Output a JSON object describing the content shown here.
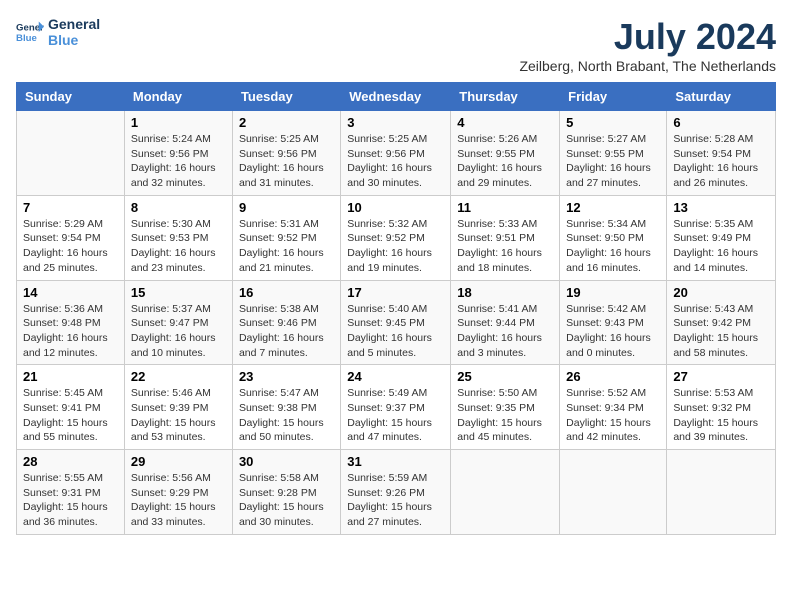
{
  "logo": {
    "line1": "General",
    "line2": "Blue"
  },
  "title": "July 2024",
  "location": "Zeilberg, North Brabant, The Netherlands",
  "headers": [
    "Sunday",
    "Monday",
    "Tuesday",
    "Wednesday",
    "Thursday",
    "Friday",
    "Saturday"
  ],
  "weeks": [
    [
      {
        "day": "",
        "info": ""
      },
      {
        "day": "1",
        "info": "Sunrise: 5:24 AM\nSunset: 9:56 PM\nDaylight: 16 hours\nand 32 minutes."
      },
      {
        "day": "2",
        "info": "Sunrise: 5:25 AM\nSunset: 9:56 PM\nDaylight: 16 hours\nand 31 minutes."
      },
      {
        "day": "3",
        "info": "Sunrise: 5:25 AM\nSunset: 9:56 PM\nDaylight: 16 hours\nand 30 minutes."
      },
      {
        "day": "4",
        "info": "Sunrise: 5:26 AM\nSunset: 9:55 PM\nDaylight: 16 hours\nand 29 minutes."
      },
      {
        "day": "5",
        "info": "Sunrise: 5:27 AM\nSunset: 9:55 PM\nDaylight: 16 hours\nand 27 minutes."
      },
      {
        "day": "6",
        "info": "Sunrise: 5:28 AM\nSunset: 9:54 PM\nDaylight: 16 hours\nand 26 minutes."
      }
    ],
    [
      {
        "day": "7",
        "info": "Sunrise: 5:29 AM\nSunset: 9:54 PM\nDaylight: 16 hours\nand 25 minutes."
      },
      {
        "day": "8",
        "info": "Sunrise: 5:30 AM\nSunset: 9:53 PM\nDaylight: 16 hours\nand 23 minutes."
      },
      {
        "day": "9",
        "info": "Sunrise: 5:31 AM\nSunset: 9:52 PM\nDaylight: 16 hours\nand 21 minutes."
      },
      {
        "day": "10",
        "info": "Sunrise: 5:32 AM\nSunset: 9:52 PM\nDaylight: 16 hours\nand 19 minutes."
      },
      {
        "day": "11",
        "info": "Sunrise: 5:33 AM\nSunset: 9:51 PM\nDaylight: 16 hours\nand 18 minutes."
      },
      {
        "day": "12",
        "info": "Sunrise: 5:34 AM\nSunset: 9:50 PM\nDaylight: 16 hours\nand 16 minutes."
      },
      {
        "day": "13",
        "info": "Sunrise: 5:35 AM\nSunset: 9:49 PM\nDaylight: 16 hours\nand 14 minutes."
      }
    ],
    [
      {
        "day": "14",
        "info": "Sunrise: 5:36 AM\nSunset: 9:48 PM\nDaylight: 16 hours\nand 12 minutes."
      },
      {
        "day": "15",
        "info": "Sunrise: 5:37 AM\nSunset: 9:47 PM\nDaylight: 16 hours\nand 10 minutes."
      },
      {
        "day": "16",
        "info": "Sunrise: 5:38 AM\nSunset: 9:46 PM\nDaylight: 16 hours\nand 7 minutes."
      },
      {
        "day": "17",
        "info": "Sunrise: 5:40 AM\nSunset: 9:45 PM\nDaylight: 16 hours\nand 5 minutes."
      },
      {
        "day": "18",
        "info": "Sunrise: 5:41 AM\nSunset: 9:44 PM\nDaylight: 16 hours\nand 3 minutes."
      },
      {
        "day": "19",
        "info": "Sunrise: 5:42 AM\nSunset: 9:43 PM\nDaylight: 16 hours\nand 0 minutes."
      },
      {
        "day": "20",
        "info": "Sunrise: 5:43 AM\nSunset: 9:42 PM\nDaylight: 15 hours\nand 58 minutes."
      }
    ],
    [
      {
        "day": "21",
        "info": "Sunrise: 5:45 AM\nSunset: 9:41 PM\nDaylight: 15 hours\nand 55 minutes."
      },
      {
        "day": "22",
        "info": "Sunrise: 5:46 AM\nSunset: 9:39 PM\nDaylight: 15 hours\nand 53 minutes."
      },
      {
        "day": "23",
        "info": "Sunrise: 5:47 AM\nSunset: 9:38 PM\nDaylight: 15 hours\nand 50 minutes."
      },
      {
        "day": "24",
        "info": "Sunrise: 5:49 AM\nSunset: 9:37 PM\nDaylight: 15 hours\nand 47 minutes."
      },
      {
        "day": "25",
        "info": "Sunrise: 5:50 AM\nSunset: 9:35 PM\nDaylight: 15 hours\nand 45 minutes."
      },
      {
        "day": "26",
        "info": "Sunrise: 5:52 AM\nSunset: 9:34 PM\nDaylight: 15 hours\nand 42 minutes."
      },
      {
        "day": "27",
        "info": "Sunrise: 5:53 AM\nSunset: 9:32 PM\nDaylight: 15 hours\nand 39 minutes."
      }
    ],
    [
      {
        "day": "28",
        "info": "Sunrise: 5:55 AM\nSunset: 9:31 PM\nDaylight: 15 hours\nand 36 minutes."
      },
      {
        "day": "29",
        "info": "Sunrise: 5:56 AM\nSunset: 9:29 PM\nDaylight: 15 hours\nand 33 minutes."
      },
      {
        "day": "30",
        "info": "Sunrise: 5:58 AM\nSunset: 9:28 PM\nDaylight: 15 hours\nand 30 minutes."
      },
      {
        "day": "31",
        "info": "Sunrise: 5:59 AM\nSunset: 9:26 PM\nDaylight: 15 hours\nand 27 minutes."
      },
      {
        "day": "",
        "info": ""
      },
      {
        "day": "",
        "info": ""
      },
      {
        "day": "",
        "info": ""
      }
    ]
  ]
}
